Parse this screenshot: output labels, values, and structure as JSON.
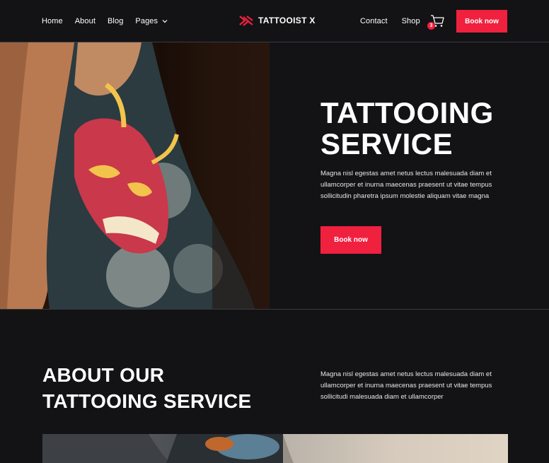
{
  "nav": {
    "left_links": [
      "Home",
      "About",
      "Blog",
      "Pages"
    ],
    "brand": "TATTOOIST X",
    "right_links": [
      "Contact",
      "Shop"
    ],
    "cart_count": "3",
    "book_button": "Book now"
  },
  "hero": {
    "title": "TATTOOING SERVICE",
    "text": "Magna nisl egestas amet netus lectus malesuada diam et ullamcorper et inurna maecenas praesent ut vitae tempus sollicitudin pharetra ipsum molestie  aliquam vitae magna",
    "button": "Book now"
  },
  "about": {
    "title": "ABOUT OUR TATTOOING SERVICE",
    "text": "Magna nisl egestas amet netus lectus malesuada diam et ullamcorper et inurna maecenas praesent ut vitae tempus sollicitudi malesuada diam et ullamcorper"
  },
  "colors": {
    "background": "#131316",
    "accent": "#f0203f"
  },
  "icons": [
    "logo-mark-icon",
    "chevron-down-icon",
    "cart-icon"
  ]
}
